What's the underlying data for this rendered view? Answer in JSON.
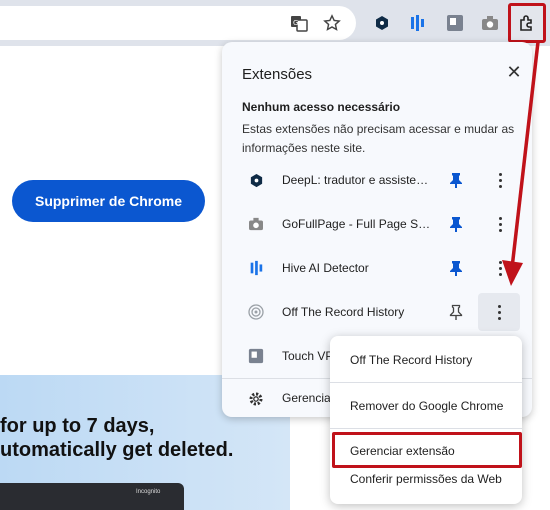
{
  "browser": {
    "toolbar_icons": [
      "translate-icon",
      "star-icon",
      "deepl-icon",
      "hive-icon",
      "touch-vpn-icon",
      "camera-icon",
      "puzzle-icon"
    ]
  },
  "page": {
    "button_label": "Supprimer de Chrome",
    "hero_line1": "for up to 7 days,",
    "hero_line2": "utomatically get deleted.",
    "window_label": "Incognito"
  },
  "panel": {
    "title": "Extensões",
    "section_heading": "Nenhum acesso necessário",
    "section_description": "Estas extensões não precisam acessar e mudar as informações neste site.",
    "extensions": [
      {
        "name": "DeepL: tradutor e assistente de escrita",
        "icon": "deepl-icon",
        "pinned": true
      },
      {
        "name": "GoFullPage - Full Page Screen Capture",
        "icon": "camera-icon",
        "pinned": true
      },
      {
        "name": "Hive AI Detector",
        "icon": "hive-icon",
        "pinned": true
      },
      {
        "name": "Off The Record History",
        "icon": "target-icon",
        "pinned": false
      },
      {
        "name": "Touch VPN",
        "icon": "touch-vpn-icon",
        "pinned": false
      }
    ],
    "manage_label": "Gerenciar extensões"
  },
  "context_menu": {
    "header": "Off The Record History",
    "items": [
      "Remover do Google Chrome",
      "Gerenciar extensão",
      "Conferir permissões da Web"
    ],
    "highlighted_item": "Gerenciar extensão"
  },
  "colors": {
    "accent": "#0b57d0",
    "annotation_red": "#c0121a",
    "pin_blue": "#0b57d0"
  }
}
